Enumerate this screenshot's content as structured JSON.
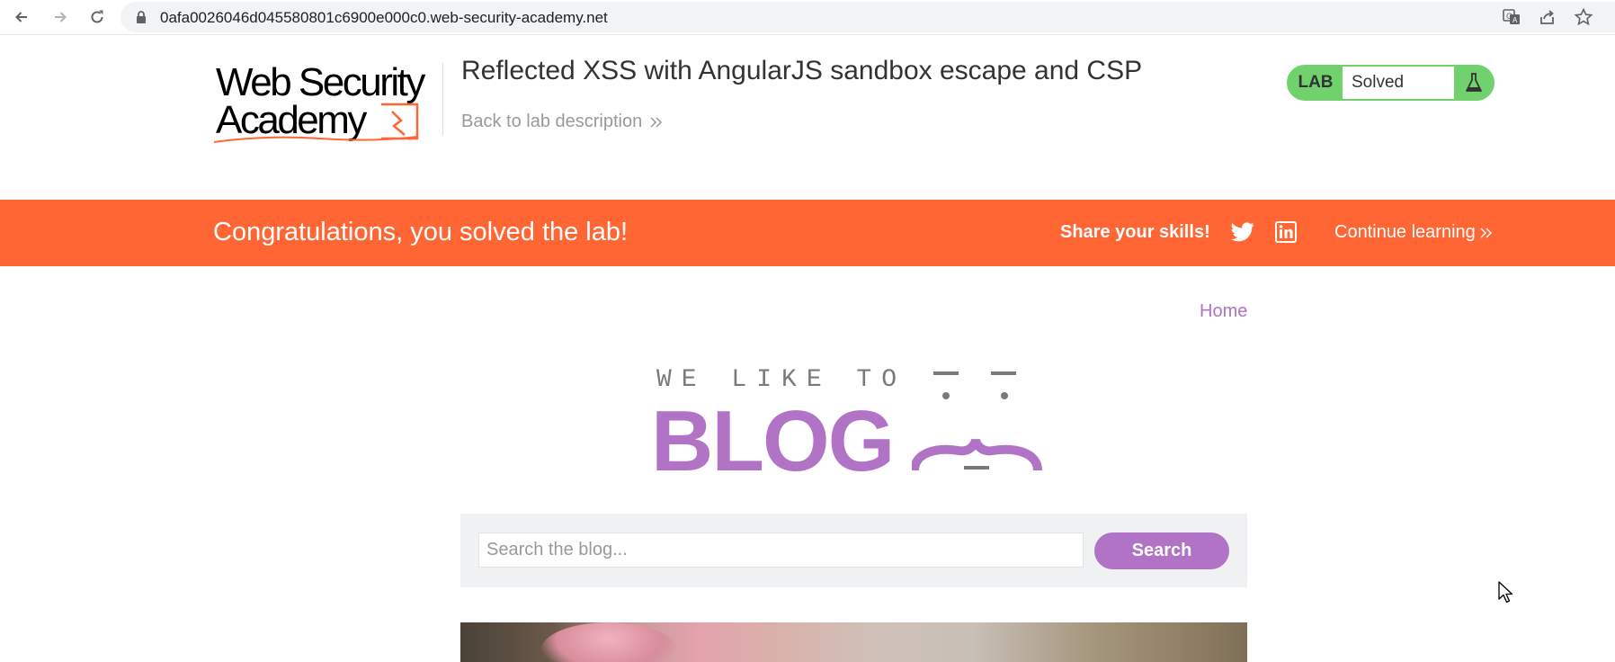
{
  "browser": {
    "url": "0afa0026046d045580801c6900e000c0.web-security-academy.net"
  },
  "header": {
    "logo_line1": "Web Security",
    "logo_line2": "Academy",
    "lab_title": "Reflected XSS with AngularJS sandbox escape and CSP",
    "back_link": "Back to lab description",
    "lab_tag": "LAB",
    "lab_status": "Solved",
    "status_color": "#70d16d"
  },
  "banner": {
    "message": "Congratulations, you solved the lab!",
    "share_label": "Share your skills!",
    "continue_label": "Continue learning",
    "color": "#ff6633"
  },
  "blog": {
    "home_link": "Home",
    "tagline": "WE LIKE TO",
    "wordmark": "BLOG",
    "accent": "#b073c5"
  },
  "search": {
    "placeholder": "Search the blog...",
    "value": "",
    "button_label": "Search"
  },
  "icons": [
    "back-icon",
    "forward-icon",
    "reload-icon",
    "lock-icon",
    "translate-icon",
    "share-icon",
    "bookmark-star-icon",
    "flask-icon",
    "twitter-icon",
    "linkedin-icon",
    "double-chevron-icon",
    "mouse-cursor-icon"
  ]
}
